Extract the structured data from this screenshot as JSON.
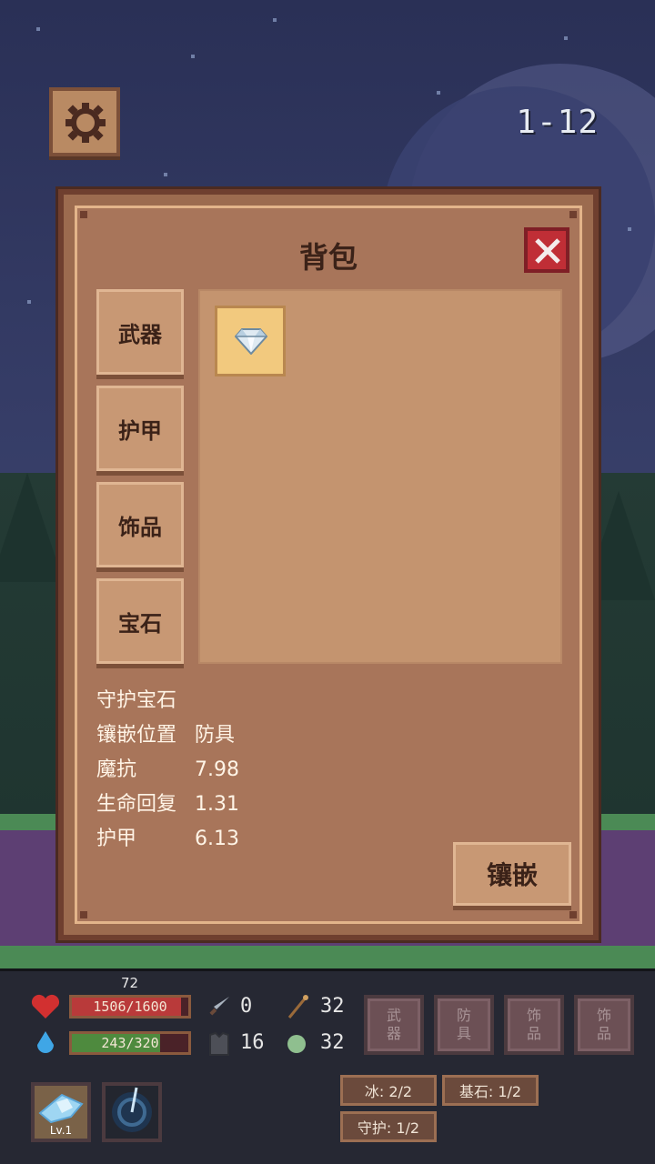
{
  "stage": "1-12",
  "inventory": {
    "title": "背包",
    "tabs": [
      "武器",
      "护甲",
      "饰品",
      "宝石"
    ],
    "items": [
      {
        "name": "diamond-gem-icon",
        "selected": true
      }
    ],
    "detail": {
      "name": "守护宝石",
      "rows": [
        {
          "label": "镶嵌位置",
          "value": "防具"
        },
        {
          "label": "魔抗",
          "value": "7.98"
        },
        {
          "label": "生命回复",
          "value": "1.31"
        },
        {
          "label": "护甲",
          "value": "6.13"
        }
      ]
    },
    "inlay_button": "镶嵌"
  },
  "hud": {
    "level_number": "72",
    "hp": {
      "text": "1506/1600",
      "ratio": 0.94,
      "color": "#b93a3a"
    },
    "mp": {
      "text": "243/320",
      "ratio": 0.76,
      "color": "#4e8a3e"
    },
    "stats": {
      "attack": "0",
      "arrow": "32",
      "armor": "16",
      "orb": "32"
    },
    "equip_slots": [
      {
        "line1": "武",
        "line2": "器"
      },
      {
        "line1": "防",
        "line2": "具"
      },
      {
        "line1": "饰",
        "line2": "品"
      },
      {
        "line1": "饰",
        "line2": "品"
      }
    ],
    "gem_chips": [
      "冰: 2/2",
      "基石: 1/2",
      "守护: 1/2"
    ],
    "skill_level": "Lv.1"
  }
}
